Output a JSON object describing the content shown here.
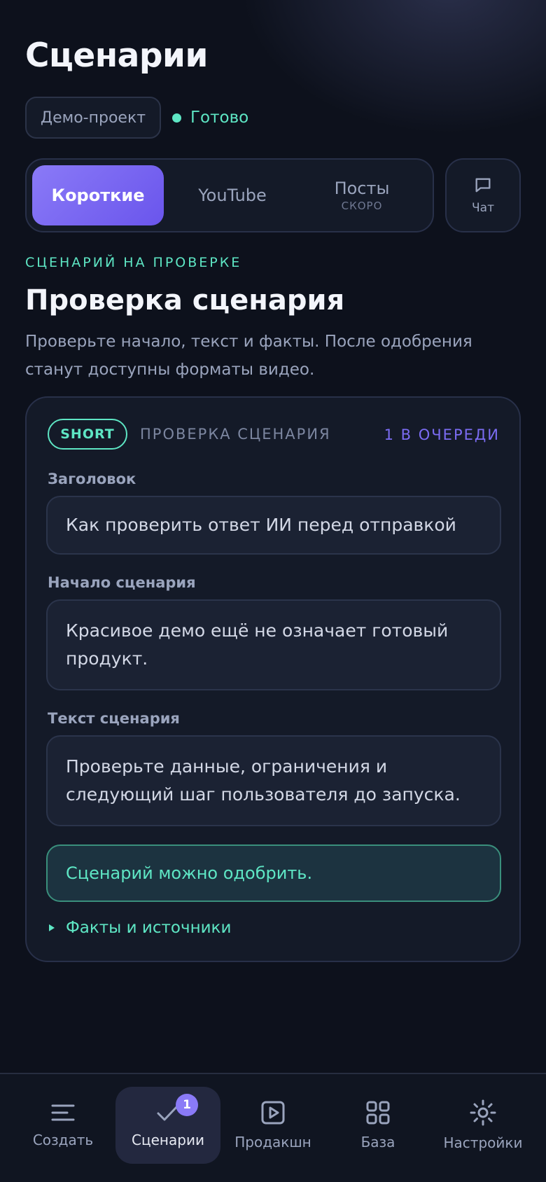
{
  "header": {
    "title": "Сценарии",
    "project": "Демо-проект",
    "status": "Готово"
  },
  "tabs": [
    {
      "label": "Короткие",
      "active": true
    },
    {
      "label": "YouTube"
    },
    {
      "label": "Посты",
      "note": "СКОРО"
    }
  ],
  "chat": {
    "label": "Чат",
    "icon": "chat-bubble-icon"
  },
  "section": {
    "eyebrow": "СЦЕНАРИЙ НА ПРОВЕРКЕ",
    "title": "Проверка сценария",
    "description": "Проверьте начало, текст и факты. После одобрения станут доступны форматы видео."
  },
  "card": {
    "badge": "SHORT",
    "kind": "ПРОВЕРКА СЦЕНАРИЯ",
    "queue": "1 В ОЧЕРЕДИ",
    "fields": [
      {
        "label": "Заголовок",
        "value": "Как проверить ответ ИИ перед отправкой"
      },
      {
        "label": "Начало сценария",
        "value": "Красивое демо ещё не означает готовый продукт."
      },
      {
        "label": "Текст сценария",
        "value": "Проверьте данные, ограничения и следующий шаг пользователя до запуска."
      }
    ],
    "notice": "Сценарий можно одобрить.",
    "facts": "Факты и источники"
  },
  "nav": [
    {
      "label": "Создать",
      "icon": "menu-lines-icon"
    },
    {
      "label": "Сценарии",
      "icon": "check-icon",
      "active": true,
      "badge": "1"
    },
    {
      "label": "Продакшн",
      "icon": "play-icon"
    },
    {
      "label": "База",
      "icon": "grid-icon"
    },
    {
      "label": "Настройки",
      "icon": "sun-gear-icon"
    }
  ],
  "colors": {
    "accent": "#8a7af7",
    "mint": "#5ee6c4",
    "background": "#0d111c",
    "card": "#141a28"
  }
}
